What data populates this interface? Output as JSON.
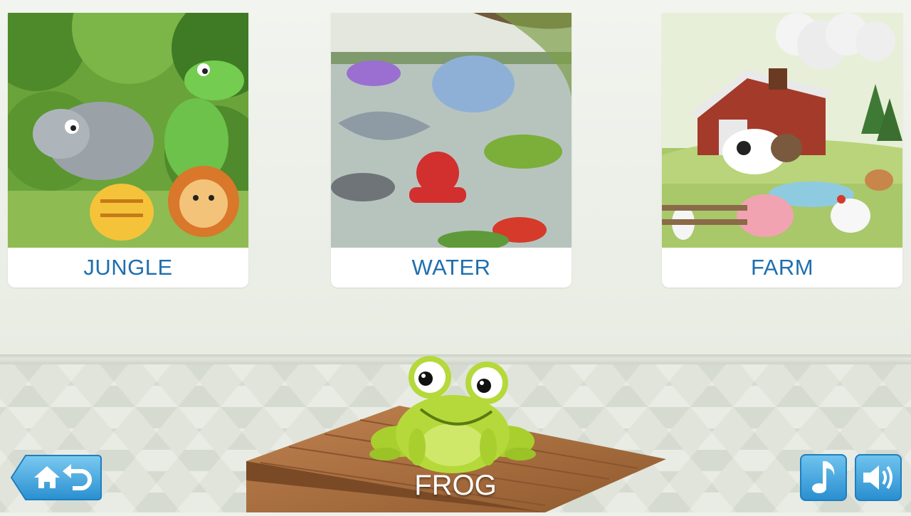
{
  "categories": [
    {
      "label": "JUNGLE",
      "icon": "jungle-scene"
    },
    {
      "label": "WATER",
      "icon": "water-scene"
    },
    {
      "label": "FARM",
      "icon": "farm-scene"
    }
  ],
  "current_animal": {
    "label": "FROG",
    "icon": "frog-illustration"
  },
  "controls": {
    "home": {
      "icon": "home-back-icon"
    },
    "music": {
      "icon": "music-note-icon"
    },
    "sound": {
      "icon": "speaker-icon"
    }
  },
  "colors": {
    "label_text": "#1f6fae",
    "button_blue": "#2a8fd0",
    "wall": "#eef1ea",
    "wood": "#a86a3a",
    "frog_green": "#b5d93a"
  }
}
